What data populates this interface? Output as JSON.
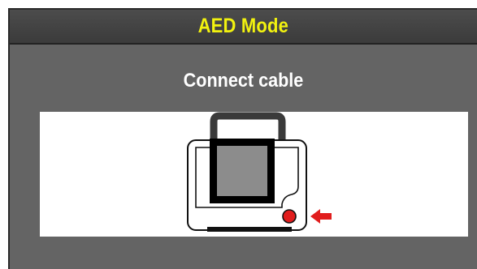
{
  "header": {
    "title": "AED Mode"
  },
  "main": {
    "prompt": "Connect cable"
  },
  "illustration": {
    "icon": "defibrillator-cable-connect-icon",
    "arrow_icon": "arrow-left-icon",
    "colors": {
      "title": "#f2f20f",
      "background": "#646464",
      "header": "#3b3b3b",
      "connector_port": "#e11d1d",
      "arrow": "#e11d1d",
      "pad": "#8c8c8c"
    }
  }
}
